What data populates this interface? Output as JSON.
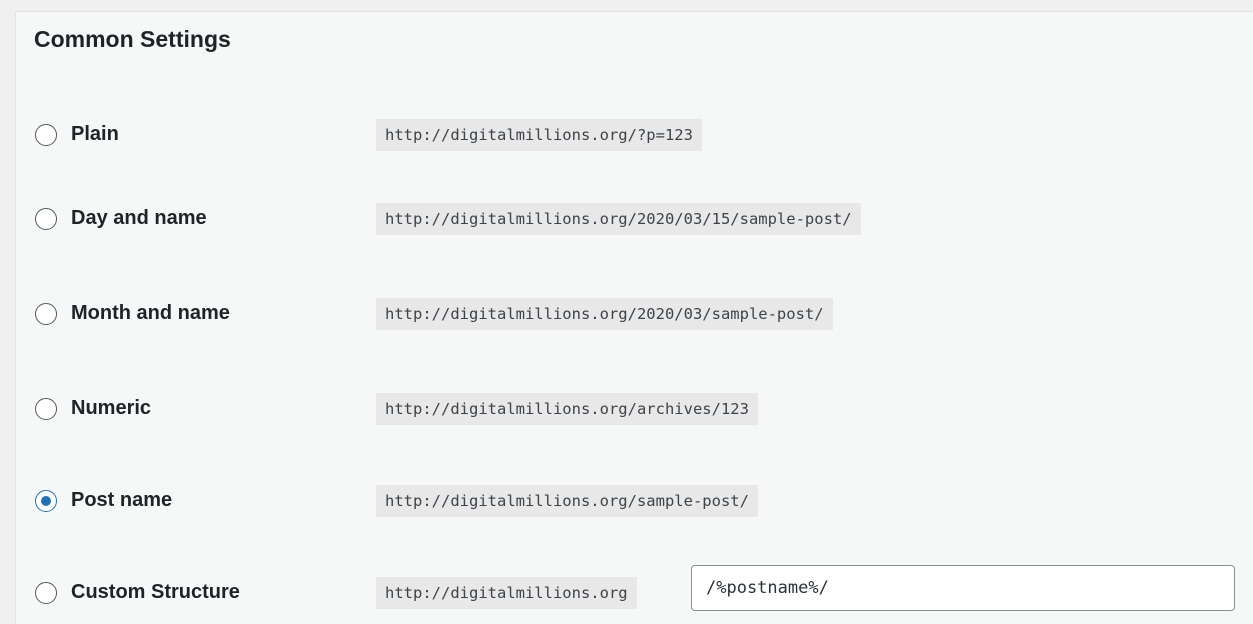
{
  "section": {
    "title": "Common Settings"
  },
  "options": [
    {
      "label": "Plain",
      "example": "http://digitalmillions.org/?p=123",
      "checked": false
    },
    {
      "label": "Day and name",
      "example": "http://digitalmillions.org/2020/03/15/sample-post/",
      "checked": false
    },
    {
      "label": "Month and name",
      "example": "http://digitalmillions.org/2020/03/sample-post/",
      "checked": false
    },
    {
      "label": "Numeric",
      "example": "http://digitalmillions.org/archives/123",
      "checked": false
    },
    {
      "label": "Post name",
      "example": "http://digitalmillions.org/sample-post/",
      "checked": true
    }
  ],
  "custom": {
    "label": "Custom Structure",
    "base_url": "http://digitalmillions.org",
    "value": "/%postname%/",
    "checked": false
  },
  "colors": {
    "accent": "#2271b1"
  }
}
